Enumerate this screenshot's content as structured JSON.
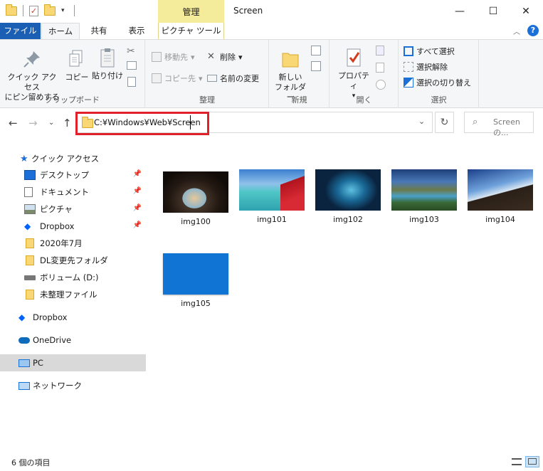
{
  "window": {
    "title": "Screen",
    "manage_tab": "管理",
    "minimize_icon": "minimize-icon",
    "maximize_icon": "maximize-icon",
    "close_icon": "close-icon"
  },
  "tabs": {
    "file": "ファイル",
    "home": "ホーム",
    "share": "共有",
    "view": "表示",
    "picture_tools": "ピクチャ ツール"
  },
  "ribbon": {
    "clipboard": {
      "label": "クリップボード",
      "pin_line1": "クイック アクセス",
      "pin_line2": "にピン留めする",
      "copy": "コピー",
      "paste": "貼り付け"
    },
    "organize": {
      "label": "整理",
      "move_to": "移動先",
      "copy_to": "コピー先",
      "delete": "削除",
      "rename": "名前の変更"
    },
    "new": {
      "label": "新規",
      "new_folder_line1": "新しい",
      "new_folder_line2": "フォルダー"
    },
    "open": {
      "label": "開く",
      "properties": "プロパティ"
    },
    "select": {
      "label": "選択",
      "select_all": "すべて選択",
      "select_none": "選択解除",
      "invert": "選択の切り替え"
    }
  },
  "address": {
    "path": "C:¥Windows¥Web¥Screen",
    "search_placeholder": "Screenの..."
  },
  "nav": {
    "quick_access": "クイック アクセス",
    "items": [
      {
        "label": "デスクトップ",
        "icon": "desktop-icon"
      },
      {
        "label": "ドキュメント",
        "icon": "document-icon"
      },
      {
        "label": "ピクチャ",
        "icon": "picture-icon"
      },
      {
        "label": "Dropbox",
        "icon": "dropbox-icon"
      },
      {
        "label": "2020年7月",
        "icon": "folder-icon"
      },
      {
        "label": "DL変更先フォルダ",
        "icon": "folder-icon"
      },
      {
        "label": "ボリューム (D:)",
        "icon": "drive-icon"
      },
      {
        "label": "未整理ファイル",
        "icon": "folder-icon"
      }
    ],
    "dropbox": "Dropbox",
    "onedrive": "OneDrive",
    "pc": "PC",
    "network": "ネットワーク"
  },
  "files": [
    {
      "name": "img100"
    },
    {
      "name": "img101"
    },
    {
      "name": "img102"
    },
    {
      "name": "img103"
    },
    {
      "name": "img104"
    },
    {
      "name": "img105"
    }
  ],
  "status": {
    "count": "6 個の項目"
  },
  "colors": {
    "file_tab": "#1a5fb4",
    "manage_tab": "#f5ec9b",
    "highlight": "#e0202a",
    "selected_nav": "#d9d9d9"
  }
}
